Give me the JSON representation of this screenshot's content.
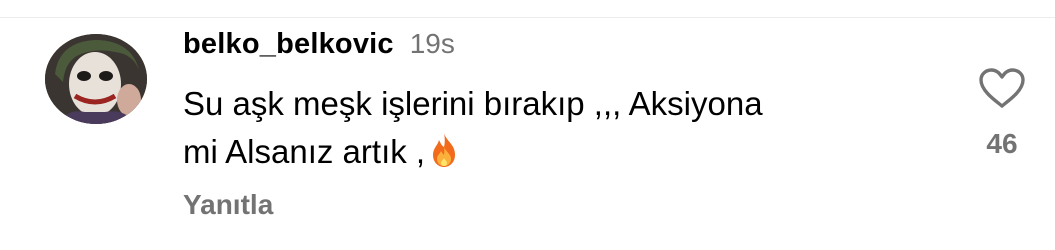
{
  "comment": {
    "username": "belko_belkovic",
    "timestamp": "19s",
    "text_line1": "Su aşk meşk işlerini bırakıp ,,, Aksiyona",
    "text_line2": "mi Alsanız artık ,",
    "emoji_icon": "fire-emoji",
    "reply_label": "Yanıtla",
    "like_icon": "heart-outline-icon",
    "like_count": "46"
  },
  "colors": {
    "secondary_text": "#737373",
    "divider": "#ececec"
  }
}
